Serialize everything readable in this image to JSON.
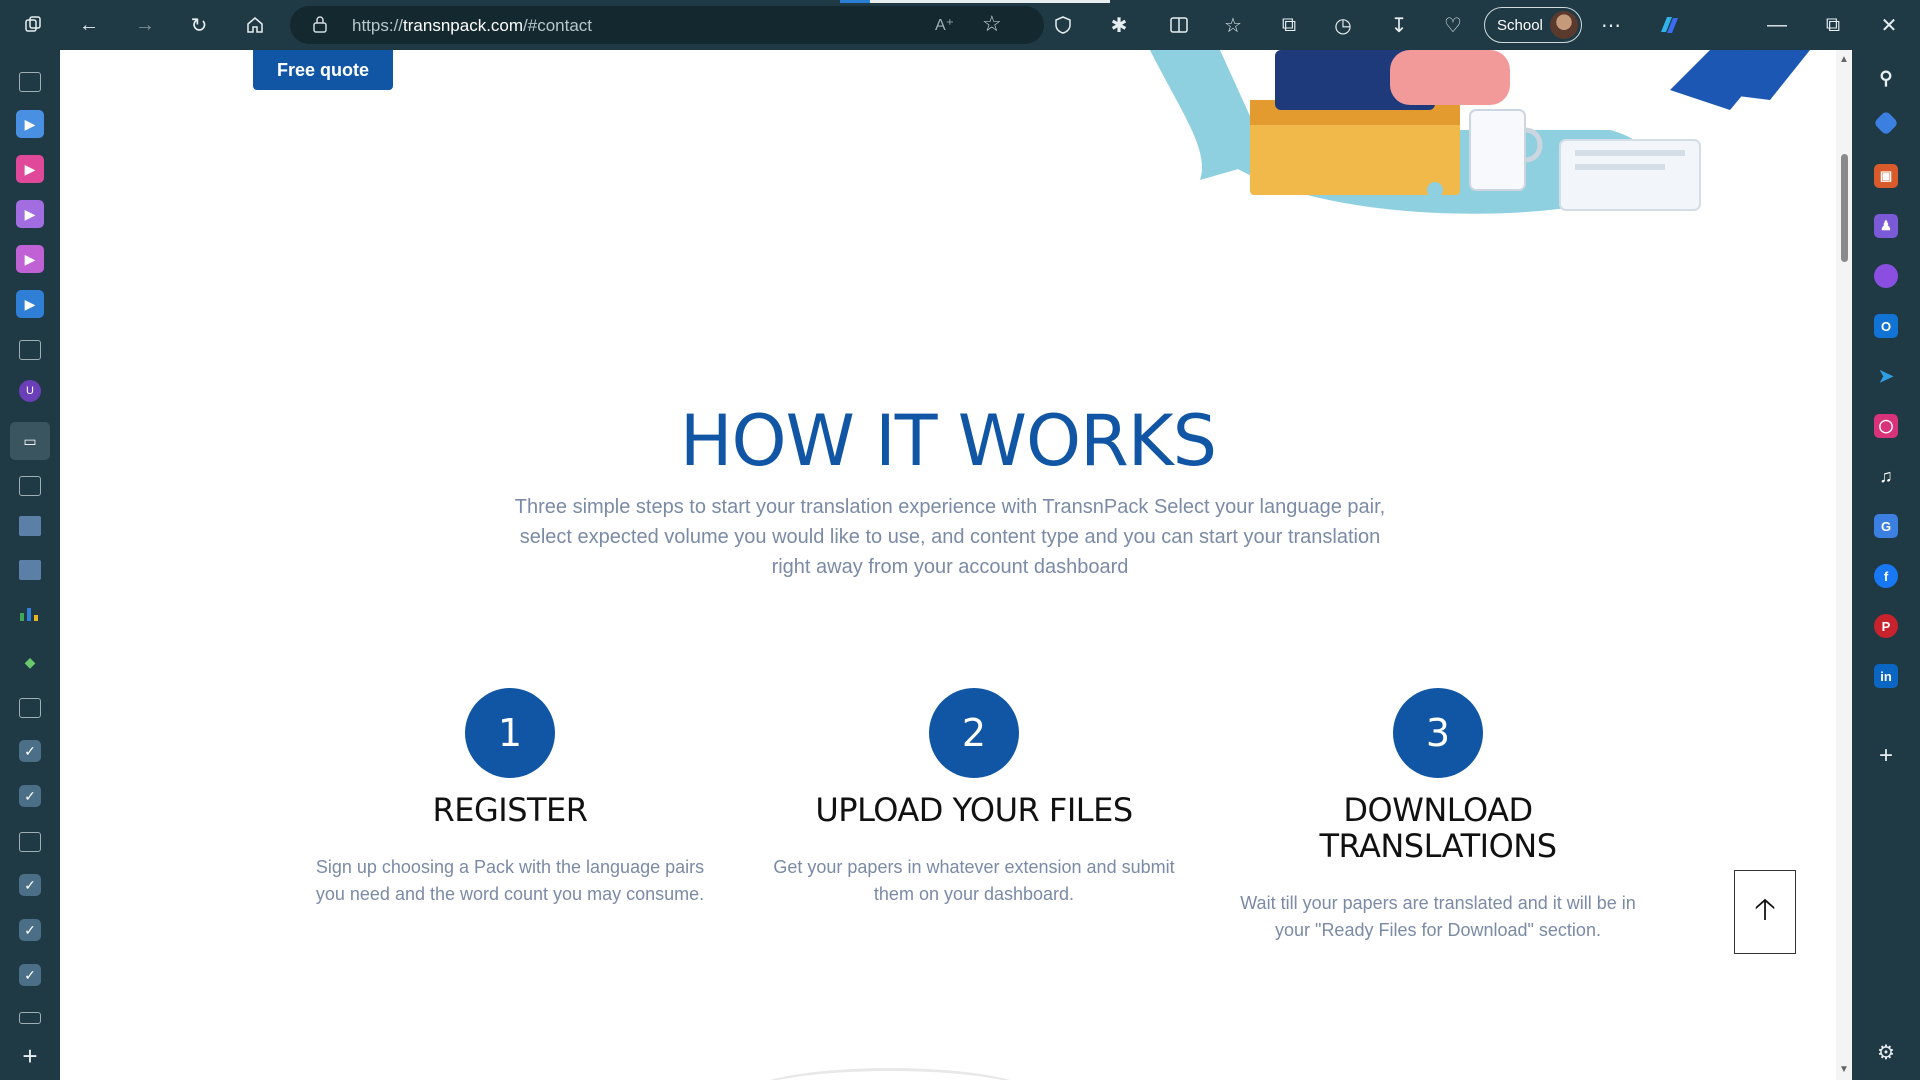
{
  "browser": {
    "url_prefix": "https://",
    "url_host": "transnpack.com",
    "url_path": "/#contact",
    "profile_label": "School"
  },
  "page": {
    "free_quote_label": "Free quote",
    "section_title": "HOW IT WORKS",
    "section_subtitle": "Three simple steps to start your translation experience with TransnPack Select your language pair, select expected volume you would like to use, and content type and you can start your translation right away from your account dashboard",
    "steps": [
      {
        "number": "1",
        "title": "REGISTER",
        "description": "Sign up choosing a Pack with the language pairs you need and the word count you may consume."
      },
      {
        "number": "2",
        "title": "UPLOAD YOUR FILES",
        "description": "Get your papers in whatever extension and submit them on your dashboard."
      },
      {
        "number": "3",
        "title": "DOWNLOAD TRANSLATIONS",
        "description": "Wait till your papers are translated and it will be in your \"Ready Files for Download\" section."
      }
    ]
  },
  "colors": {
    "brand_blue": "#1156a5",
    "browser_chrome": "#1f3a45"
  }
}
